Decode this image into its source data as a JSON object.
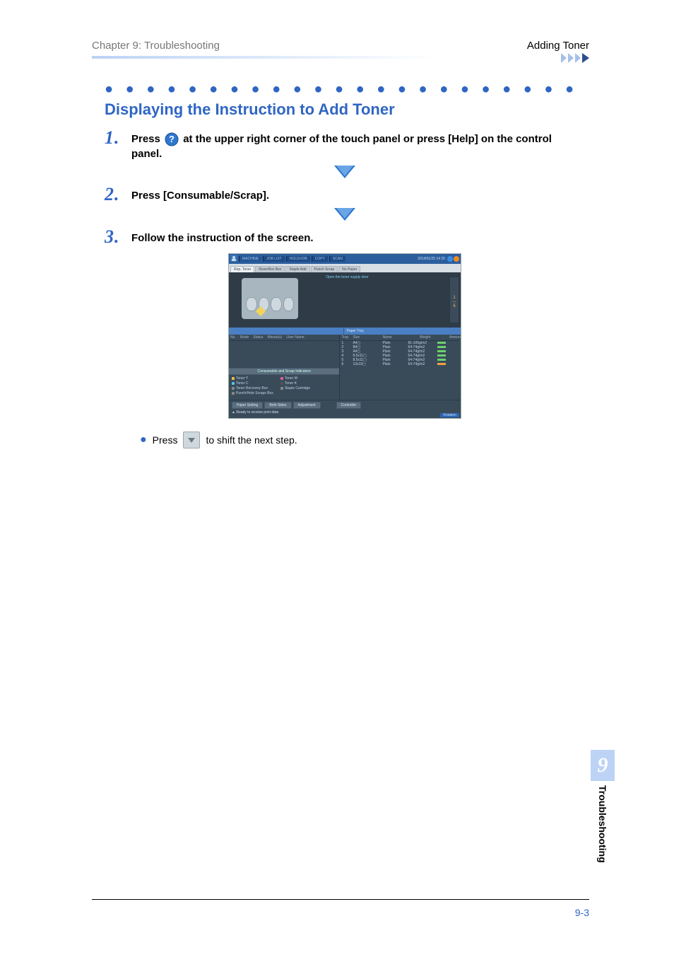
{
  "header": {
    "left": "Chapter 9: Troubleshooting",
    "right": "Adding Toner"
  },
  "section_title": "Displaying the Instruction to Add Toner",
  "steps": {
    "s1_pre": "Press ",
    "s1_post": " at the upper right corner of the touch panel or press [Help] on the control panel.",
    "s2": "Press [Consumable/Scrap].",
    "s3": "Follow the instruction of the screen."
  },
  "screenshot": {
    "top_tabs": {
      "t1": "MACHINE",
      "t2": "JOB LIST",
      "t3": "HOLD/JOB",
      "t4": "",
      "t5": "COPY",
      "t6": "SCAN"
    },
    "datetime": "2014/01/25 14 26",
    "sub_tabs": {
      "a": "Rep. Toner",
      "b": "ReserBox Box",
      "c": "Staple Add",
      "d": "Punch Scrap",
      "e": "No Paper"
    },
    "mid_text": "Open the toner supply door",
    "counter": "1\n6",
    "split_right": "Paper Tray",
    "job_head": {
      "c1": "No.",
      "c2": "Mode",
      "c3": "Status",
      "c4": "Minute(s)",
      "c5": "User Name"
    },
    "cons_title": "Consumable and Scrap Indicators",
    "cons": {
      "y": "Toner Y",
      "m": "Toner M",
      "c": "Toner C",
      "k": "Toner K",
      "box": "Toner Recovery Box",
      "staple": "Staple Cartridge",
      "punch": "Punch/Hole Scraps Box"
    },
    "tray_head": {
      "c1": "Tray",
      "c2": "Size",
      "c3": "",
      "c4": "Name",
      "c5": "Weight",
      "c6": "Amount"
    },
    "trays": [
      {
        "n": "1",
        "size": "A4▢",
        "name": "Plain",
        "wt": "81-105g/m2"
      },
      {
        "n": "2",
        "size": "B4▢",
        "name": "Plain",
        "wt": "64-74g/m2"
      },
      {
        "n": "3",
        "size": "A4▢",
        "name": "Plain",
        "wt": "64-74g/m2"
      },
      {
        "n": "4",
        "size": "8.5x11▢",
        "name": "Plain",
        "wt": "64-74g/m2"
      },
      {
        "n": "5",
        "size": "8.5x11▢",
        "name": "Plain",
        "wt": "64-74g/m2"
      },
      {
        "n": "6",
        "size": "13x19▢",
        "name": "Plain",
        "wt": "64-74g/m2"
      }
    ],
    "buttons": {
      "b1": "Paper Setting",
      "b2": "Both Sides",
      "b3": "Adjustment",
      "b4": "Controller"
    },
    "status": "Ready to receive print data",
    "rotation": "Rotation"
  },
  "bullet": {
    "pre": "Press ",
    "post": " to shift the next step."
  },
  "side": {
    "num": "9",
    "label": "Troubleshooting"
  },
  "footer_page": "9-3"
}
